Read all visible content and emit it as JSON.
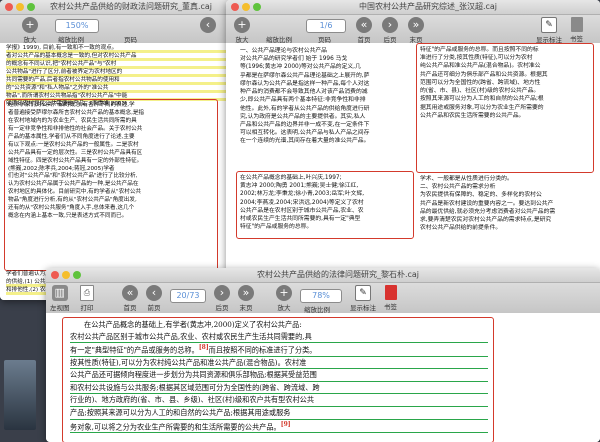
{
  "window_left": {
    "title": "农村公共产品供给的财政法问题研究_董真.caj",
    "page_display": "150%",
    "toolbar": [
      "放大",
      "缩放比例",
      "页码"
    ],
    "page_lines_top": [
      "学报》1999), 目前,有一致和不一致的观点。",
      "者对公共产品的基本概念是一致的,但对农村公共产品",
      "的概念有不同认识,把\"农村公共产品\"与\"农村",
      "公共物品\"进行了区分,前者被界定为农村地区的",
      "共同需要的产品,后者指农村公共物品的使用和",
      "的\"公共资源\"和\"私人物品\"之外的\"准公共",
      "物品\",而所谓农村公共物品指\"农村公共产品\"中能",
      "够满足农村居民公共需要的产品。(李雪峰,2003)"
    ],
    "page_lines_boxed": [
      "经济学家们对公共产品的概念,有各种不同的表述,学",
      "者普遍接受萨缪尔森所言农村公共产品的基本概念,是指",
      "在农村地域内的为农业生产、农民生活共同所需的具",
      "有一定非竞争性和非排他性的社会产品。关于农村公共",
      "产品的基本属性,学者们从不同角度进行了论述,主要",
      "有以下观点:一是农村公共产品的一般属性。二是农村",
      "公共产品具有一定的层次性。三是农村公共产品具有区",
      "域性特征。四是农村公共产品具有一定的外部性特征。",
      "(熊巍,2002;陈孝兵,2004;蒋冠,2005)学者",
      "们也对\"公共产品\"和\"农村公共产品\"进行了比较分析,",
      "认为农村公共产品属于公共产品的一种,是公共产品在",
      "农村地区的具体化。目前研究中,有的学者从\"农村公共",
      "物品\"角度进行分析,有的从\"农村公共产品\"角度出发,",
      "还有的从\"农村公共服务\"角度入手,总体来看,这几个",
      "概念在内涵上基本一致,只是表述方式不同而已。"
    ],
    "page_lines_bottom": [
      "学者们普遍认为,公共产品的供给应由政府负责,",
      "的供给,(1) 公共产品和私人产品的划分标准是竞争性",
      "和排他性,(2) 农村公共产品与私人物品之间存在",
      "\"混合物品\"……"
    ]
  },
  "window_right": {
    "title": "中国农村公共产品研究综述_张汉超.caj",
    "page_display": "1/6",
    "toolbar": [
      "放大",
      "缩放比例",
      "页码",
      "首页",
      "后页",
      "末页",
      "显示标注",
      "书签"
    ],
    "left_column_top": [
      "一、公共产品理论与农村公共产品",
      "对公共产品的研究学者们 始于 1996 马戈",
      "等(1996;黄志冲 2000)等对公共产品的定义,几",
      "乎都是在萨缪尔森公共产品理论基础之上展开的,萨",
      "缪尔森认为公共产品是指这样一种产品,每个人对这",
      "种产品的消费都不会导致其他人对该产品消费的减",
      "少,即公共产品具有两个基本特征:非竞争性和非排",
      "他性。此外,有的学者从公共产品的供给角度进行研",
      "究,认为政府是公共产品的主要提供者。其实,私人",
      "产品和公共产品的边界并非一成不变,在一定条件下",
      "可以相互转化。这表明,公共产品与私人产品之间存",
      "在一个连续的光谱,其间存在着大量的准公共产品。"
    ],
    "left_column_boxed": [
      "在公共产品概念的基础上,叶兴庆,1997;",
      "黄志冲 2000;陶勇 2001;熊巍;吴士健;徐江红,",
      "2002;林万龙;李秉龙;徐小青,2003;岳军;叶文辉,",
      "2004;李燕凌,2004;宋洪远,2004)等定义了农村",
      "公共产品是在农村区别于城市公共产品,农业、农",
      "村或农民生产生活共同所需要的,具有一定\"典型",
      "特征\"的产品或服务的总称。"
    ],
    "right_column_boxed": [
      "特征\"的产品或服务的总称。而且按照不同的标",
      "准进行了分类,按其性质(特征),可以分为农村",
      "纯公共产品和准公共产品(混合物品)。农村准公",
      "共产品还可细分为俱乐部产品和公共资源。根据其",
      "范围可以分为全国性的(跨省、跨流域)、地方性",
      "的(省、市、县)、社区(村)级的农村公共产品。",
      "按照其来源可以分为人工的和自然的公共产品;根",
      "据其用途或服务对象,可以分为农业生产所需要的",
      "公共产品和农民生活所需要的公共产品。"
    ],
    "right_column_after": [
      "学术、一般都是从性质进行分类的。",
      "二、农村公共产品的需求分析",
      "为农民提供有保障的、稳定的、多样化的农村公",
      "共产品是新农村建设的重要内容之一。要达到公共产",
      "品的最优供给,就必须充分考虑消费者对公共产品的需",
      "求,要弄清楚农民对农村公共产品的需求特点,是研究",
      "农村公共产品供给的前提条件。"
    ]
  },
  "window_front": {
    "title": "农村公共产品供给的法律问题研究_黎石朴.caj",
    "page_display": "20/73",
    "zoom_display": "78%",
    "toolbar": [
      "左视图",
      "打印",
      "首页",
      "前页",
      "后页",
      "末页",
      "放大",
      "缩放比例",
      "显示标注",
      "书签"
    ],
    "lines": [
      "在公共产品概念的基础上,有学者(黄志冲,2000)定义了农村公共产品:",
      "农村公共产品区别于城市公共产品,农业、农村或农民生产生活共同需要的,具",
      "有一定\"典型特征\"的产品或服务的总称。",
      "而且按照不同的标准进行了分类。",
      "按其性质(特征),可以分为农村纯公共产品和准公共产品(混合物品)。农村准",
      "公共产品还可据倾向程度进一步划分为共同资源和俱乐部物品;根据其受益范围",
      "和农村公共设施与公共服务;根据其区域范围可分为全国性的(跨省、跨流域、跨",
      "行业的)、地方政府的(省、市、县、乡级)、社区(村)级和农户共有型农村公共",
      "产品;按照其来源可以分为人工的和自然的公共产品;根据其用途或服务",
      "务对象,可以将之分为农业生产所需要的和生活所需要的公共产品。"
    ],
    "footnote_marks": [
      "[8]",
      "[9]"
    ]
  }
}
